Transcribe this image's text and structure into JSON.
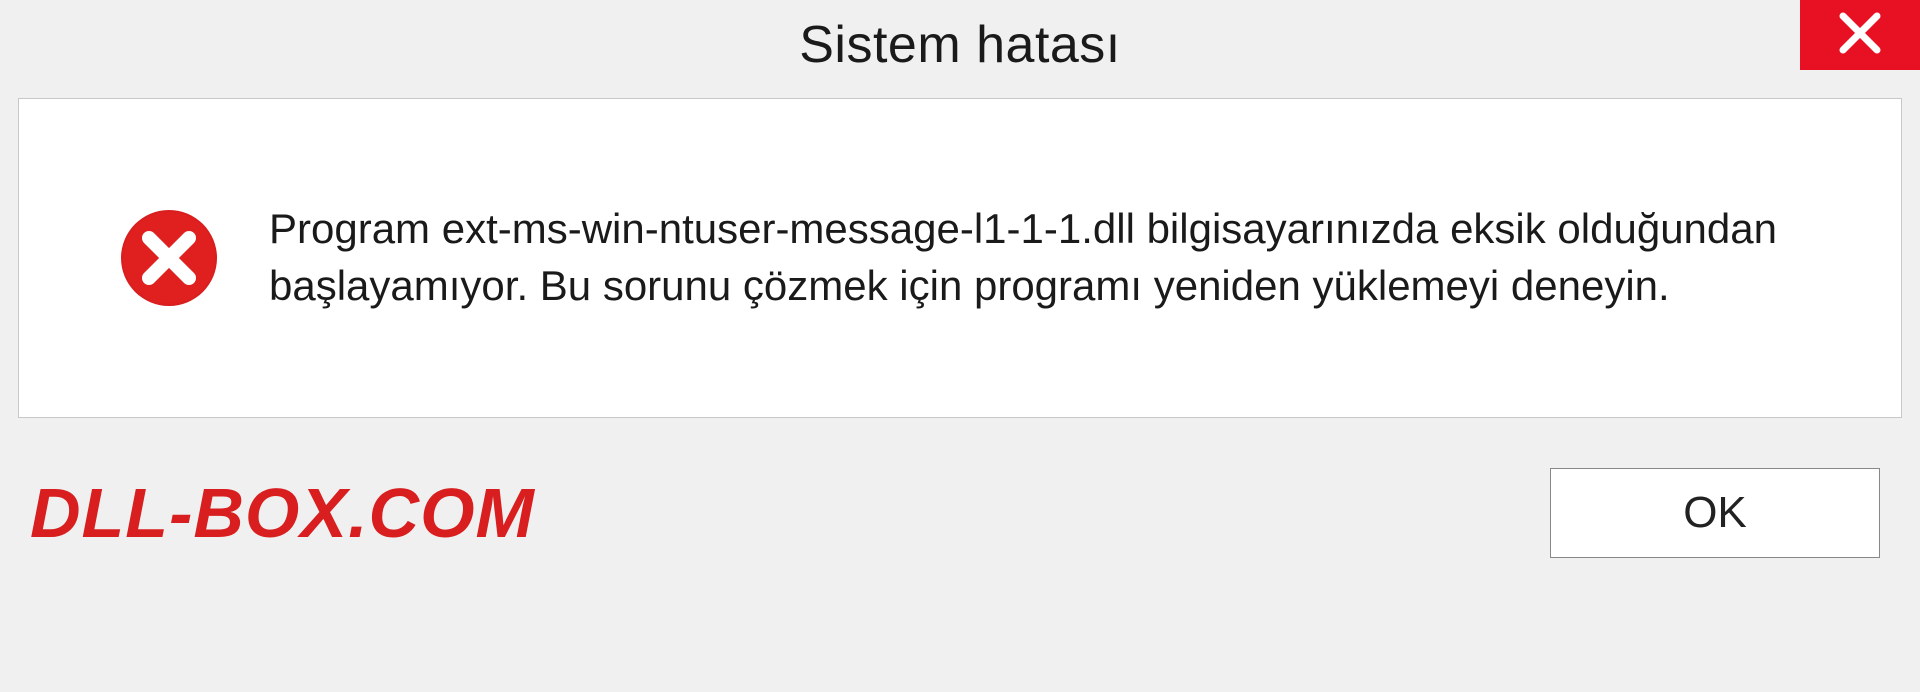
{
  "dialog": {
    "title": "Sistem hatası",
    "message": "Program ext-ms-win-ntuser-message-l1-1-1.dll bilgisayarınızda eksik olduğundan başlayamıyor. Bu sorunu çözmek için programı yeniden yüklemeyi deneyin.",
    "ok_label": "OK"
  },
  "watermark": {
    "text": "DLL-BOX.COM"
  },
  "colors": {
    "close_button": "#e81123",
    "error_icon": "#d81e1e",
    "watermark": "#d81e1e"
  }
}
